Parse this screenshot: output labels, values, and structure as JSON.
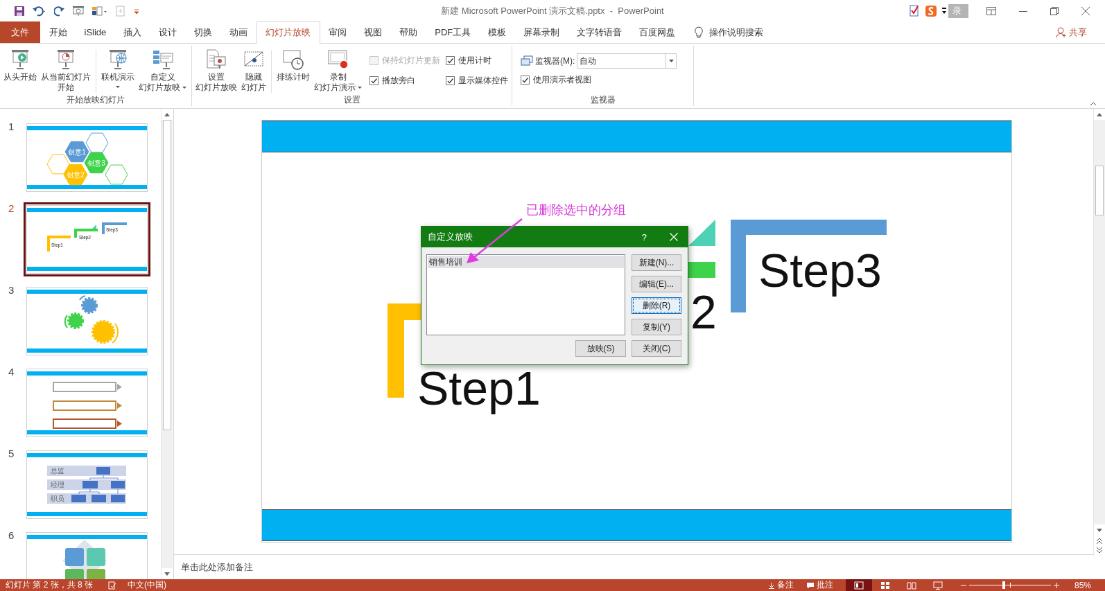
{
  "window": {
    "title": "新建 Microsoft PowerPoint 演示文稿.pptx  -  PowerPoint",
    "toolbar_text": "录"
  },
  "ribbon_tabs": [
    {
      "label": "文件",
      "kind": "file",
      "selected": false
    },
    {
      "label": "开始",
      "kind": "tab",
      "selected": false
    },
    {
      "label": "iSlide",
      "kind": "tab",
      "selected": false
    },
    {
      "label": "插入",
      "kind": "tab",
      "selected": false
    },
    {
      "label": "设计",
      "kind": "tab",
      "selected": false
    },
    {
      "label": "切换",
      "kind": "tab",
      "selected": false
    },
    {
      "label": "动画",
      "kind": "tab",
      "selected": false
    },
    {
      "label": "幻灯片放映",
      "kind": "tab",
      "selected": true
    },
    {
      "label": "审阅",
      "kind": "tab",
      "selected": false
    },
    {
      "label": "视图",
      "kind": "tab",
      "selected": false
    },
    {
      "label": "帮助",
      "kind": "tab",
      "selected": false
    },
    {
      "label": "PDF工具",
      "kind": "tab",
      "selected": false
    },
    {
      "label": "模板",
      "kind": "tab",
      "selected": false
    },
    {
      "label": "屏幕录制",
      "kind": "tab",
      "selected": false
    },
    {
      "label": "文字转语音",
      "kind": "tab",
      "selected": false
    },
    {
      "label": "百度网盘",
      "kind": "tab",
      "selected": false
    }
  ],
  "tell_me": "操作说明搜索",
  "share": "共享",
  "ribbon_groups": [
    {
      "label": "开始放映幻灯片",
      "items": [
        {
          "kind": "large",
          "label": [
            "从头开始"
          ]
        },
        {
          "kind": "large",
          "label": [
            "从当前幻灯片",
            "开始"
          ]
        },
        {
          "kind": "separator"
        },
        {
          "kind": "large",
          "label": [
            "联机演示"
          ],
          "dropdown": true
        },
        {
          "kind": "large",
          "label": [
            "自定义",
            "幻灯片放映"
          ],
          "dropdown": true
        }
      ]
    },
    {
      "label": "设置",
      "items": [
        {
          "kind": "large",
          "label": [
            "设置",
            "幻灯片放映"
          ]
        },
        {
          "kind": "large",
          "label": [
            "隐藏",
            "幻灯片"
          ]
        },
        {
          "kind": "separator"
        },
        {
          "kind": "large",
          "label": [
            "排练计时"
          ]
        },
        {
          "kind": "large",
          "label": [
            "录制",
            "幻灯片演示"
          ],
          "dropdown": true
        },
        {
          "kind": "checks",
          "items": [
            {
              "label": "保持幻灯片更新",
              "checked": false,
              "disabled": true
            },
            {
              "label": "播放旁白",
              "checked": true,
              "disabled": false
            }
          ]
        },
        {
          "kind": "checks",
          "items": [
            {
              "label": "使用计时",
              "checked": true,
              "disabled": false
            },
            {
              "label": "显示媒体控件",
              "checked": true,
              "disabled": false
            }
          ]
        }
      ]
    },
    {
      "label": "监视器",
      "items": [
        {
          "kind": "monitor",
          "label": "监视器(M):",
          "value": "自动",
          "check": {
            "label": "使用演示者视图",
            "checked": true,
            "disabled": false
          }
        }
      ]
    }
  ],
  "slides": [
    {
      "number": "1",
      "selected": false,
      "kind": "hexagons",
      "texts": [
        "创意1",
        "创意2",
        "创意3"
      ]
    },
    {
      "number": "2",
      "selected": true,
      "kind": "steps",
      "texts": [
        "Step1",
        "Step2",
        "Step3"
      ]
    },
    {
      "number": "3",
      "selected": false,
      "kind": "gears"
    },
    {
      "number": "4",
      "selected": false,
      "kind": "arrows"
    },
    {
      "number": "5",
      "selected": false,
      "kind": "org",
      "texts": [
        "总监",
        "经理",
        "职员"
      ]
    },
    {
      "number": "6",
      "selected": false,
      "kind": "tiles"
    }
  ],
  "slide": {
    "labels": [
      {
        "text": "Step1"
      },
      {
        "text": "2"
      },
      {
        "text": "Step3"
      }
    ]
  },
  "annotation": {
    "text": "已删除选中的分组"
  },
  "dialog": {
    "title": "自定义放映",
    "help": "?",
    "shows": [
      {
        "name": "销售培训",
        "selected": true
      }
    ],
    "buttons": [
      {
        "label": "新建(N)...",
        "focused": false
      },
      {
        "label": "编辑(E)...",
        "focused": false
      },
      {
        "label": "删除(R)",
        "focused": true
      },
      {
        "label": "复制(Y)",
        "focused": false
      },
      {
        "label": "放映(S)",
        "focused": false
      },
      {
        "label": "关闭(C)",
        "focused": false
      }
    ]
  },
  "notes": {
    "placeholder": "单击此处添加备注"
  },
  "status_bar": {
    "slide_info": "幻灯片 第 2 张，共 8 张",
    "language": "中文(中国)",
    "notes": "备注",
    "comments": "批注",
    "views": [
      {
        "selected": true
      },
      {
        "selected": false
      },
      {
        "selected": false
      },
      {
        "selected": false
      }
    ],
    "zoom": {
      "level": 0.42,
      "reading": "85%"
    }
  }
}
